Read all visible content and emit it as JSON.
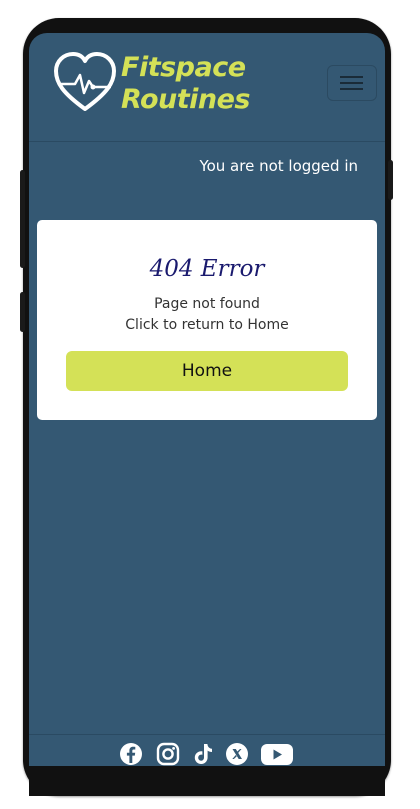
{
  "brand": {
    "line1": "Fitspace",
    "line2": "Routines",
    "logo_icon": "heart-pulse-icon"
  },
  "nav": {
    "toggler_icon": "hamburger-menu-icon"
  },
  "status": {
    "login_text": "You are not logged in"
  },
  "error_card": {
    "title": "404 Error",
    "message_line1": "Page not found",
    "message_line2": "Click to return to Home",
    "home_button_label": "Home"
  },
  "footer": {
    "social_icons": [
      "facebook-icon",
      "instagram-icon",
      "tiktok-icon",
      "x-icon",
      "youtube-icon"
    ]
  },
  "colors": {
    "background": "#345873",
    "accent": "#d4e157",
    "title": "#1a1a6e",
    "card": "#ffffff"
  }
}
